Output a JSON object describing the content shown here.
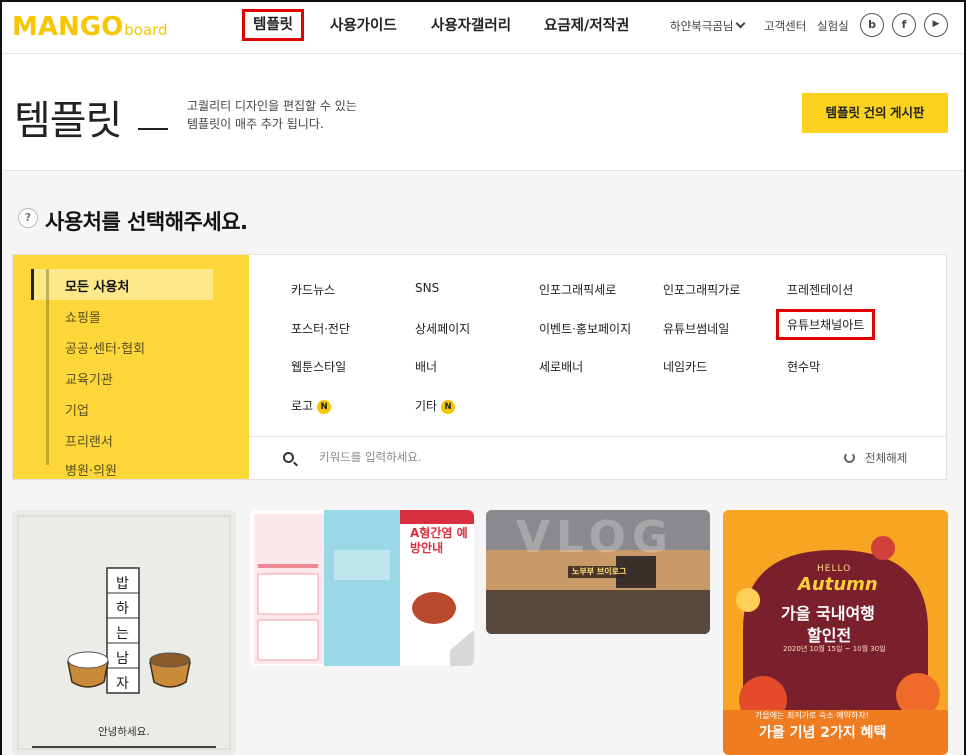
{
  "header": {
    "logo_main": "MANGO",
    "logo_sub": "board",
    "nav": [
      {
        "label": "템플릿"
      },
      {
        "label": "사용가이드"
      },
      {
        "label": "사용자갤러리"
      },
      {
        "label": "요금제/저작권"
      }
    ],
    "user_name": "하얀북극곰님",
    "support": "고객센터",
    "lab": "실험실",
    "social": [
      {
        "label": "b",
        "icon": "blog-icon"
      },
      {
        "label": "f",
        "icon": "facebook-icon"
      },
      {
        "label": "▶",
        "icon": "youtube-icon"
      }
    ]
  },
  "hero": {
    "title": "템플릿",
    "description": "고퀄리티 디자인을 편집할 수 있는\n템플릿이 매주 추가 됩니다.",
    "board_button": "템플릿 건의 게시판"
  },
  "section": {
    "help_badge": "?",
    "title": "사용처를 선택해주세요."
  },
  "sidebar": {
    "items": [
      {
        "label": "모든 사용처"
      },
      {
        "label": "쇼핑몰"
      },
      {
        "label": "공공·센터·협회"
      },
      {
        "label": "교육기관"
      },
      {
        "label": "기업"
      },
      {
        "label": "프리랜서"
      },
      {
        "label": "병원·의원"
      }
    ]
  },
  "categories": {
    "row1": [
      "카드뉴스",
      "SNS",
      "인포그래픽세로",
      "인포그래픽가로",
      "프레젠테이션"
    ],
    "row2": [
      "포스터·전단",
      "상세페이지",
      "이벤트·홍보페이지",
      "유튜브썸네일",
      "유튜브채널아트"
    ],
    "row3": [
      "웹툰스타일",
      "배너",
      "세로배너",
      "네임카드",
      "현수막"
    ],
    "row4": [
      "로고",
      "기타"
    ],
    "new_badge": "N"
  },
  "search": {
    "placeholder": "키워드를 입력하세요.",
    "reset_label": "전체해제"
  },
  "cards": {
    "card1": {
      "chars": [
        "밥",
        "하",
        "는",
        "남",
        "자"
      ],
      "caption": "안녕하세요."
    },
    "card2": {
      "title": "A형간염 예방안내"
    },
    "card3": {
      "title": "VLOG",
      "banner": "노부부 브이로그"
    },
    "card4": {
      "hello": "HELLO",
      "autumn": "Autumn",
      "line1": "가을 국내여행",
      "line2": "할인전",
      "date": "2020년 10월 15일 ~ 10월 30일",
      "sub": "가을에는 최저가로 숙소 예약하자!",
      "bottom": "가을 기념 2가지 혜택"
    }
  },
  "colors": {
    "brand": "#f7c600",
    "highlight": "#e00000",
    "sidebar": "#fdd73a"
  }
}
